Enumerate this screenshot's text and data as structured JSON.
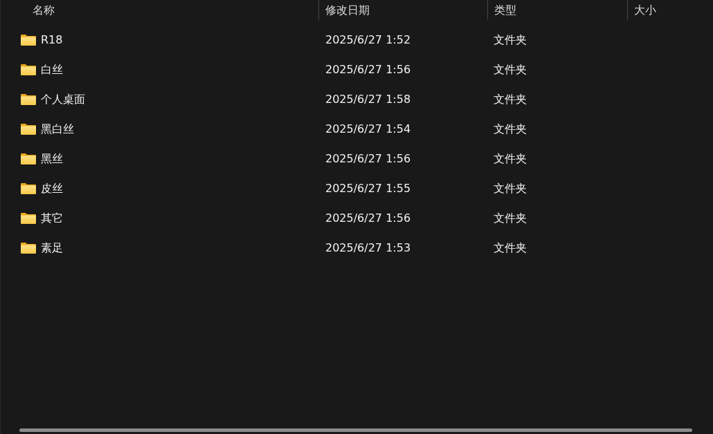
{
  "columns": [
    {
      "label": "名称"
    },
    {
      "label": "修改日期"
    },
    {
      "label": "类型"
    },
    {
      "label": "大小"
    }
  ],
  "rows": [
    {
      "name": "R18",
      "modified": "2025/6/27 1:52",
      "type": "文件夹"
    },
    {
      "name": "白丝",
      "modified": "2025/6/27 1:56",
      "type": "文件夹"
    },
    {
      "name": "个人桌面",
      "modified": "2025/6/27 1:58",
      "type": "文件夹"
    },
    {
      "name": "黑白丝",
      "modified": "2025/6/27 1:54",
      "type": "文件夹"
    },
    {
      "name": "黑丝",
      "modified": "2025/6/27 1:56",
      "type": "文件夹"
    },
    {
      "name": "皮丝",
      "modified": "2025/6/27 1:55",
      "type": "文件夹"
    },
    {
      "name": "其它",
      "modified": "2025/6/27 1:56",
      "type": "文件夹"
    },
    {
      "name": "素足",
      "modified": "2025/6/27 1:53",
      "type": "文件夹"
    }
  ]
}
